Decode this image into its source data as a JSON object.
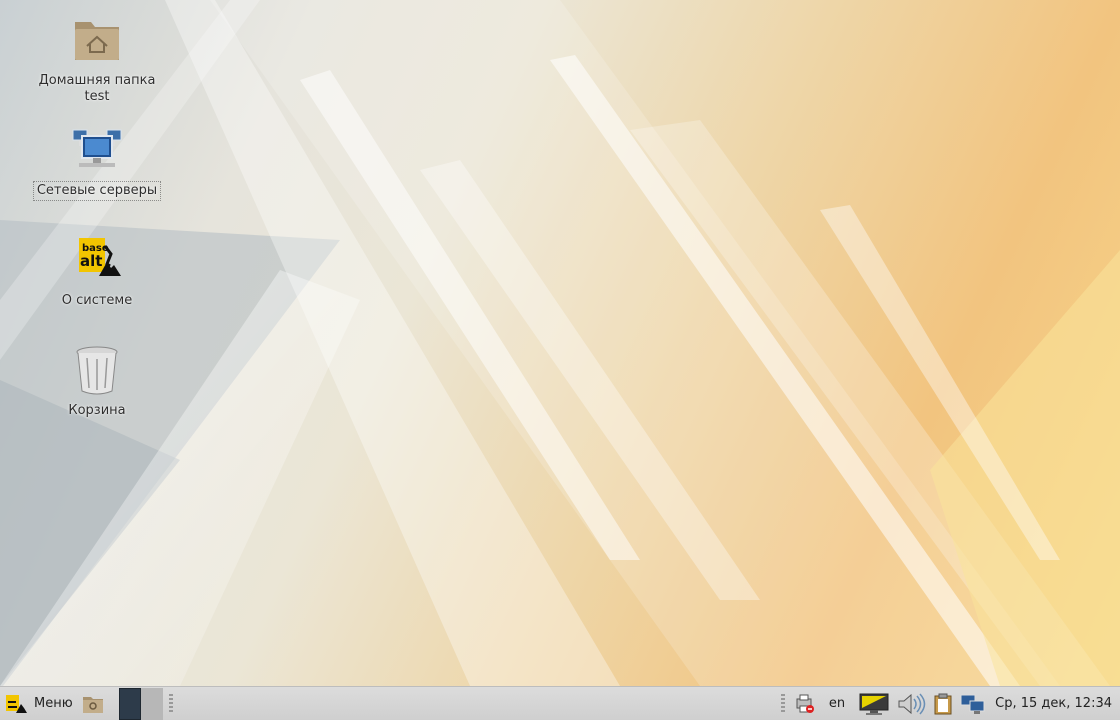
{
  "desktop": {
    "icons": [
      {
        "label": "Домашняя папка test",
        "icon": "home-folder-icon"
      },
      {
        "label": "Сетевые серверы",
        "icon": "network-servers-icon"
      },
      {
        "label": "О системе",
        "icon": "basealt-logo-icon"
      },
      {
        "label": "Корзина",
        "icon": "trash-icon"
      }
    ]
  },
  "panel": {
    "menu_label": "Меню",
    "keyboard_layout": "en",
    "clock": "Ср, 15 дек, 12:34"
  },
  "logo": {
    "line1": "base",
    "line2": "alt"
  },
  "colors": {
    "panel_bg": "#d4d4d4",
    "active_workspace": "#2d3b4a",
    "logo_yellow": "#f2c500"
  }
}
